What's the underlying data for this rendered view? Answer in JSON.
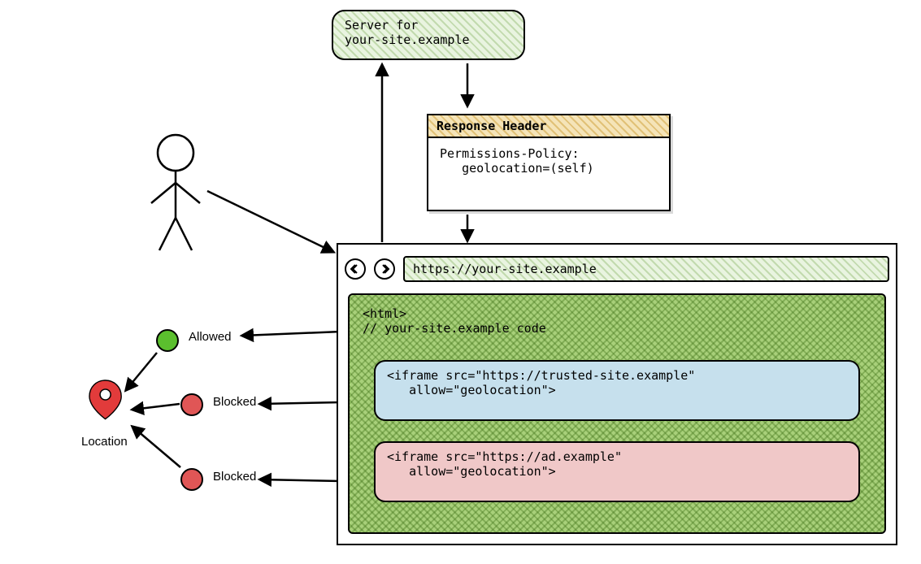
{
  "server": {
    "line1": "Server for",
    "line2": "your-site.example"
  },
  "response": {
    "title": "Response Header",
    "body": "Permissions-Policy:\n   geolocation=(self)"
  },
  "browser": {
    "url": "https://your-site.example",
    "html_line1": "<html>",
    "html_line2": "// your-site.example code",
    "iframe_trusted": "<iframe src=\"https://trusted-site.example\"\n   allow=\"geolocation\">",
    "iframe_ad": "<iframe src=\"https://ad.example\"\n   allow=\"geolocation\">"
  },
  "statuses": {
    "allowed": "Allowed",
    "blocked1": "Blocked",
    "blocked2": "Blocked"
  },
  "location_label": "Location",
  "icons": {
    "back": "back-icon",
    "forward": "forward-icon",
    "location_pin": "location-pin-icon",
    "stick_figure": "user-icon"
  },
  "colors": {
    "green_hatch": "#a8d07a",
    "light_green_hatch": "#e9f4e0",
    "orange_hatch": "#f5e4b8",
    "blue_fill": "#c6e0ed",
    "pink_fill": "#f0c8c8",
    "dot_green": "#5bbf2e",
    "dot_red": "#e05656",
    "pin_red": "#e23b3b"
  }
}
